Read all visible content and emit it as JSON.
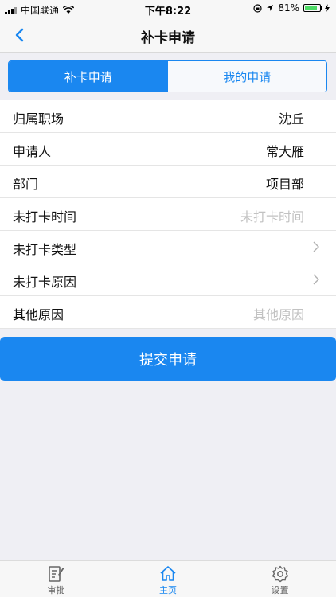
{
  "status_bar": {
    "carrier": "中国联通",
    "time": "下午8:22",
    "battery": "81%"
  },
  "nav": {
    "title": "补卡申请"
  },
  "tabs": [
    {
      "label": "补卡申请"
    },
    {
      "label": "我的申请"
    }
  ],
  "form": {
    "rows": [
      {
        "label": "归属职场",
        "value": "沈丘"
      },
      {
        "label": "申请人",
        "value": "常大雁"
      },
      {
        "label": "部门",
        "value": "项目部"
      },
      {
        "label": "未打卡时间",
        "placeholder": "未打卡时间"
      },
      {
        "label": "未打卡类型"
      },
      {
        "label": "未打卡原因"
      },
      {
        "label": "其他原因",
        "placeholder": "其他原因"
      }
    ]
  },
  "submit_label": "提交申请",
  "tab_bar": [
    {
      "label": "审批",
      "icon": "approval-icon"
    },
    {
      "label": "主页",
      "icon": "home-icon"
    },
    {
      "label": "设置",
      "icon": "settings-icon"
    }
  ],
  "colors": {
    "accent": "#1a87f0",
    "background": "#efeff4"
  }
}
